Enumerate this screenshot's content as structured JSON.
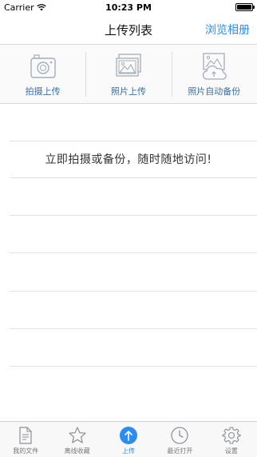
{
  "status_bar": {
    "carrier": "Carrier",
    "time": "10:23 PM",
    "battery_level": 1.0
  },
  "nav": {
    "title": "上传列表",
    "right_button": "浏览相册"
  },
  "actions": [
    {
      "label": "拍摄上传",
      "icon": "camera-icon"
    },
    {
      "label": "照片上传",
      "icon": "photos-icon"
    },
    {
      "label": "照片自动备份",
      "icon": "auto-backup-icon"
    }
  ],
  "empty_state": {
    "message": "立即拍摄或备份，随时随地访问!"
  },
  "tabs": [
    {
      "label": "我的文件",
      "icon": "document-icon",
      "active": false
    },
    {
      "label": "离线收藏",
      "icon": "star-icon",
      "active": false
    },
    {
      "label": "上传",
      "icon": "upload-icon",
      "active": true
    },
    {
      "label": "最近打开",
      "icon": "clock-icon",
      "active": false
    },
    {
      "label": "设置",
      "icon": "gear-icon",
      "active": false
    }
  ],
  "colors": {
    "accent": "#2d8cf0",
    "action_label": "#3d6fa6",
    "icon_gray": "#9aa3ad"
  }
}
